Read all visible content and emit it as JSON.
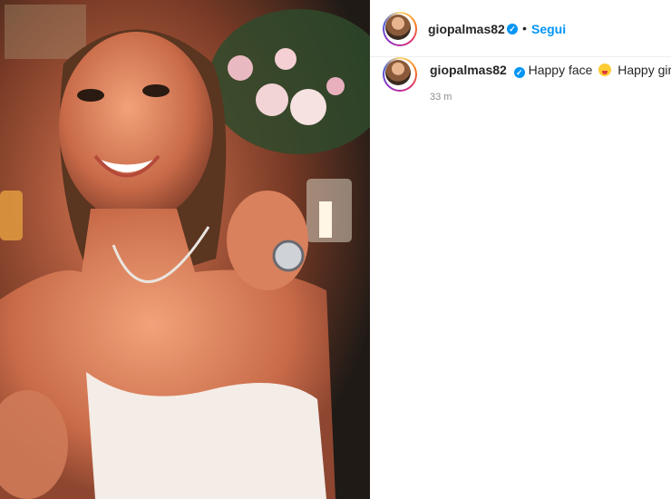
{
  "post": {
    "username": "giopalmas82",
    "follow_label": "Segui",
    "separator": "•",
    "caption_text_1": "Happy face",
    "caption_text_2": "Happy girl",
    "caption_emoji_icon": "zany-face-icon",
    "timestamp": "33 m"
  },
  "colors": {
    "accent": "#0095f6",
    "text": "#262626",
    "muted": "#8e8e8e"
  }
}
